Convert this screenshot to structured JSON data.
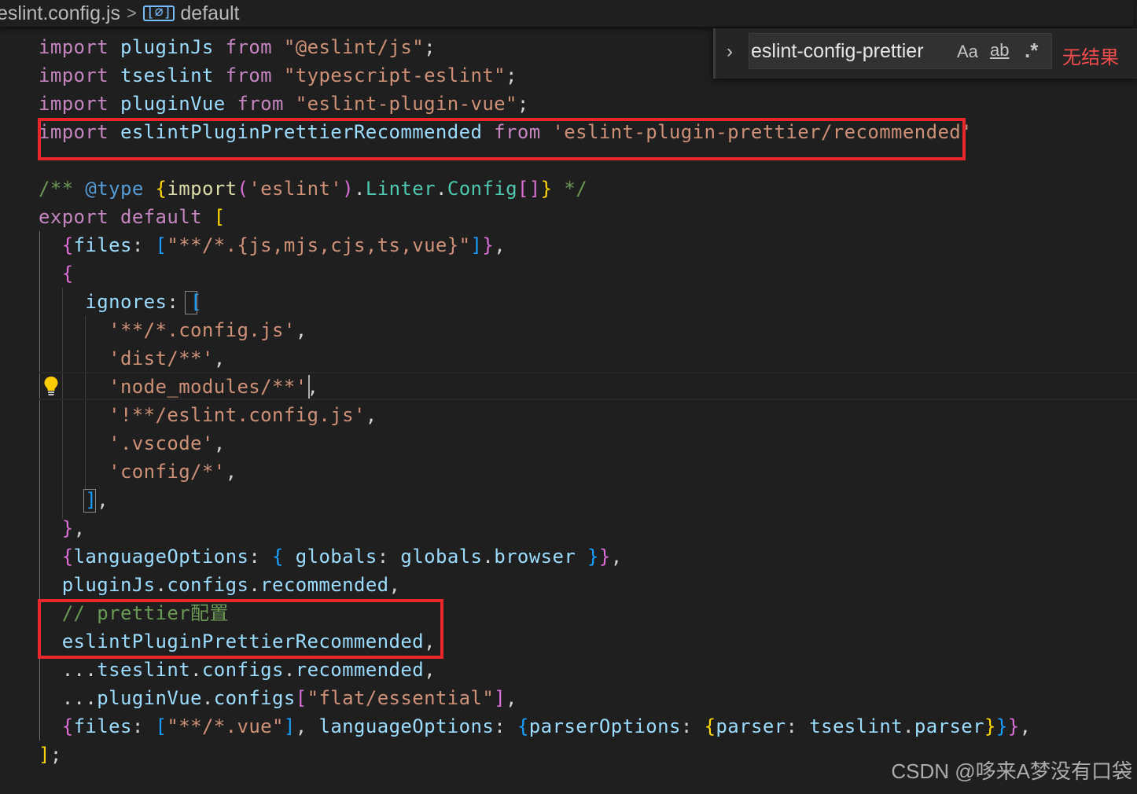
{
  "breadcrumb": {
    "file": "eslint.config.js",
    "separator": ">",
    "symbol_icon": "symbol-variable-icon",
    "symbol_icon_glyph": "[⌀]",
    "symbol": "default"
  },
  "find": {
    "toggle_glyph": "›",
    "query": "eslint-config-prettier",
    "match_case": "Aa",
    "whole_word": "ab",
    "regex": ".*",
    "result": "无结果"
  },
  "code": {
    "l1": {
      "kw1": "import",
      "name": "pluginJs",
      "kw2": "from",
      "src": "\"@eslint/js\"",
      "end": ";"
    },
    "l2": {
      "kw1": "import",
      "name": "tseslint",
      "kw2": "from",
      "src": "\"typescript-eslint\"",
      "end": ";"
    },
    "l3": {
      "kw1": "import",
      "name": "pluginVue",
      "kw2": "from",
      "src": "\"eslint-plugin-vue\"",
      "end": ";"
    },
    "l4": {
      "kw1": "import",
      "name": "eslintPluginPrettierRecommended",
      "kw2": "from",
      "src": "'eslint-plugin-prettier/recommended'"
    },
    "l6": {
      "open": "/**",
      "tag": "@type",
      "b1": "{",
      "fn": "import",
      "p1": "(",
      "arg": "'eslint'",
      "p2": ")",
      "dot": ".",
      "ty1": "Linter",
      "dot2": ".",
      "ty2": "Config",
      "arr": "[]",
      "b2": "}",
      "close": "*/"
    },
    "l7": {
      "kw": "export",
      "def": "default",
      "br": "["
    },
    "l8": {
      "b1": "{",
      "key": "files",
      "colon": ":",
      "b2": "[",
      "val": "\"**/*.{js,mjs,cjs,ts,vue}\"",
      "b3": "]",
      "b4": "}",
      "end": ","
    },
    "l9": {
      "b": "{"
    },
    "l10": {
      "key": "ignores",
      "colon": ":",
      "b": "["
    },
    "l11": {
      "val": "'**/*.config.js'",
      "end": ","
    },
    "l12": {
      "val": "'dist/**'",
      "end": ","
    },
    "l13": {
      "val": "'node_modules/**'",
      "end": ","
    },
    "l14": {
      "val": "'!**/eslint.config.js'",
      "end": ","
    },
    "l15": {
      "val": "'.vscode'",
      "end": ","
    },
    "l16": {
      "val": "'config/*'",
      "end": ","
    },
    "l17": {
      "b": "]",
      "end": ","
    },
    "l18": {
      "b": "}",
      "end": ","
    },
    "l19": {
      "b1": "{",
      "key": "languageOptions",
      "colon": ":",
      "b2": "{",
      "key2": "globals",
      "colon2": ":",
      "obj": "globals",
      "dot": ".",
      "prop": "browser",
      "b3": "}",
      "b4": "}",
      "end": ","
    },
    "l20": {
      "obj": "pluginJs",
      "dot1": ".",
      "p1": "configs",
      "dot2": ".",
      "p2": "recommended",
      "end": ","
    },
    "l21": {
      "comment": "// prettier配置"
    },
    "l22": {
      "name": "eslintPluginPrettierRecommended",
      "end": ","
    },
    "l23": {
      "spread": "...",
      "obj": "tseslint",
      "dot1": ".",
      "p1": "configs",
      "dot2": ".",
      "p2": "recommended",
      "end": ","
    },
    "l24": {
      "spread": "...",
      "obj": "pluginVue",
      "dot": ".",
      "p1": "configs",
      "b1": "[",
      "val": "\"flat/essential\"",
      "b2": "]",
      "end": ","
    },
    "l25": {
      "b1": "{",
      "key": "files",
      "colon": ":",
      "b2": "[",
      "val": "\"**/*.vue\"",
      "b3": "]",
      "comma": ",",
      "key2": "languageOptions",
      "colon2": ":",
      "b4": "{",
      "key3": "parserOptions",
      "colon3": ":",
      "b5": "{",
      "key4": "parser",
      "colon4": ":",
      "obj": "tseslint",
      "dot": ".",
      "prop": "parser",
      "b6": "}",
      "b7": "}",
      "b8": "}",
      "end": ","
    },
    "l26": {
      "b": "]",
      "end": ";"
    }
  },
  "watermark": "CSDN @哆来A梦没有口袋",
  "colors": {
    "background": "#1f1f1f",
    "keyword": "#c586c0",
    "variable": "#9cdcfe",
    "string": "#ce9178",
    "comment": "#6a9955",
    "annotation": "#e8262b",
    "no_result": "#f14c4c"
  }
}
